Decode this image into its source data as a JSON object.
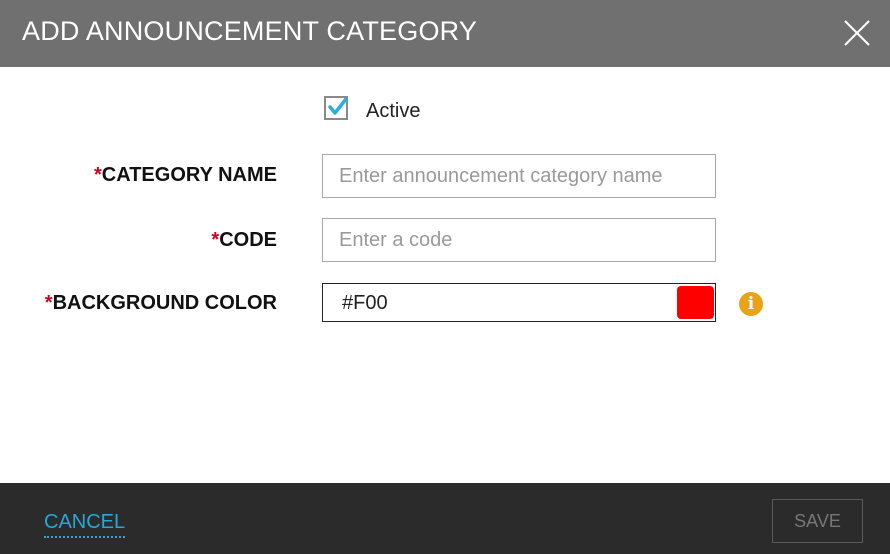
{
  "dialog": {
    "title": "ADD ANNOUNCEMENT CATEGORY",
    "close_icon": "close-icon"
  },
  "form": {
    "active": {
      "label": "Active",
      "checked": true
    },
    "required_marker": "*",
    "category_name": {
      "label": "CATEGORY NAME",
      "value": "",
      "placeholder": "Enter announcement category name"
    },
    "code": {
      "label": "CODE",
      "value": "",
      "placeholder": "Enter a code"
    },
    "background_color": {
      "label": "BACKGROUND COLOR",
      "value": "#F00",
      "swatch_color": "#ff0000"
    },
    "info_icon": {
      "name": "info-icon",
      "glyph": "i",
      "color": "#e8a317"
    }
  },
  "footer": {
    "cancel_label": "CANCEL",
    "save_label": "SAVE"
  },
  "colors": {
    "header_bg": "#707070",
    "footer_bg": "#2b2b2b",
    "accent": "#25a8d6",
    "checkbox_check": "#29aee0",
    "required": "#d0021b"
  }
}
